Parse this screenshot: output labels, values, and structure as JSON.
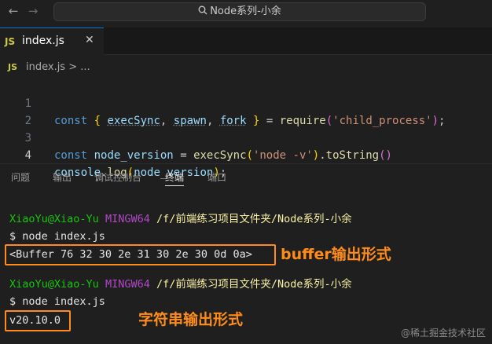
{
  "titlebar": {
    "search_text": "Node系列-小余",
    "back_icon": "arrow-left-icon",
    "forward_icon": "arrow-right-icon"
  },
  "tab": {
    "badge": "JS",
    "label": "index.js",
    "close": "✕"
  },
  "breadcrumb": {
    "badge": "JS",
    "text": "index.js > ..."
  },
  "editor": {
    "lines": [
      {
        "num": "1"
      },
      {
        "num": "2"
      },
      {
        "num": "3"
      },
      {
        "num": "4"
      }
    ],
    "tokens": {
      "const": "const",
      "ob": "{",
      "execSync": "execSync",
      "comma": ",",
      "spawn": "spawn",
      "fork": "fork",
      "cb": "}",
      "eq": "=",
      "require": "require",
      "lp": "(",
      "rp": ")",
      "semi": ";",
      "child_process": "'child_process'",
      "node_version": "node_version",
      "node_v": "'node -v'",
      "toString": "toString",
      "console": "console",
      "dot": ".",
      "log": "log"
    }
  },
  "panel": {
    "tabs": [
      "问题",
      "输出",
      "调试控制台",
      "终端",
      "端口"
    ],
    "active": "终端"
  },
  "terminal": {
    "prompt_user": "XiaoYu@Xiao-Yu",
    "prompt_ming": "MINGW64",
    "prompt_path": "/f/前端练习项目文件夹/Node系列-小余",
    "cmd": "$ node index.js",
    "output_buffer": "<Buffer 76 32 30 2e 31 30 2e 30 0d 0a>",
    "output_string": "v20.10.0",
    "annotation_buffer": "buffer输出形式",
    "annotation_string": "字符串输出形式"
  },
  "watermark": "@稀土掘金技术社区",
  "colors": {
    "accent": "#ff8c1a",
    "user_green": "#16c60c",
    "mingw_magenta": "#b148c6",
    "path_yellow": "#f9f1a5"
  }
}
